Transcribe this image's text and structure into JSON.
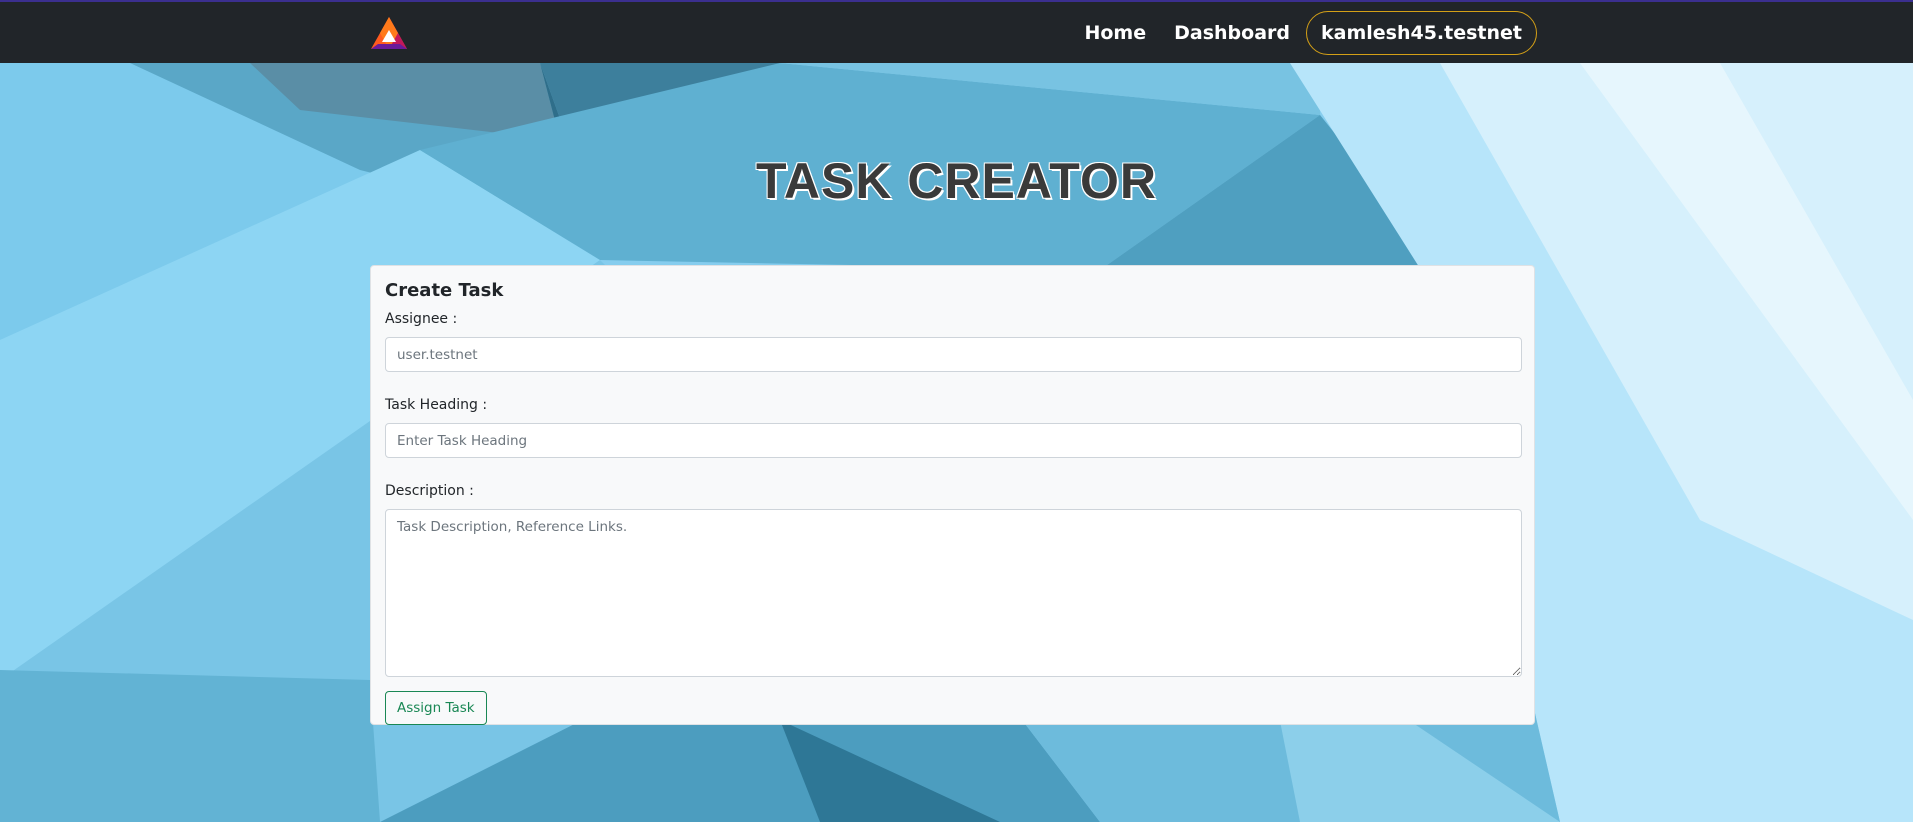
{
  "colors": {
    "navbar_bg": "#212529",
    "account_border": "#d4a017",
    "button_green": "#198754",
    "background_blue": "#8fd3f2"
  },
  "navbar": {
    "logo_icon": "brave-triangle-logo",
    "links": [
      {
        "label": "Home"
      },
      {
        "label": "Dashboard"
      }
    ],
    "account_label": "kamlesh45.testnet"
  },
  "page": {
    "title": "TASK CREATOR"
  },
  "form": {
    "heading": "Create Task",
    "assignee": {
      "label": "Assignee :",
      "placeholder": "user.testnet"
    },
    "task_heading": {
      "label": "Task Heading :",
      "placeholder": "Enter Task Heading"
    },
    "description": {
      "label": "Description :",
      "placeholder": "Task Description, Reference Links."
    },
    "submit_label": "Assign Task"
  }
}
